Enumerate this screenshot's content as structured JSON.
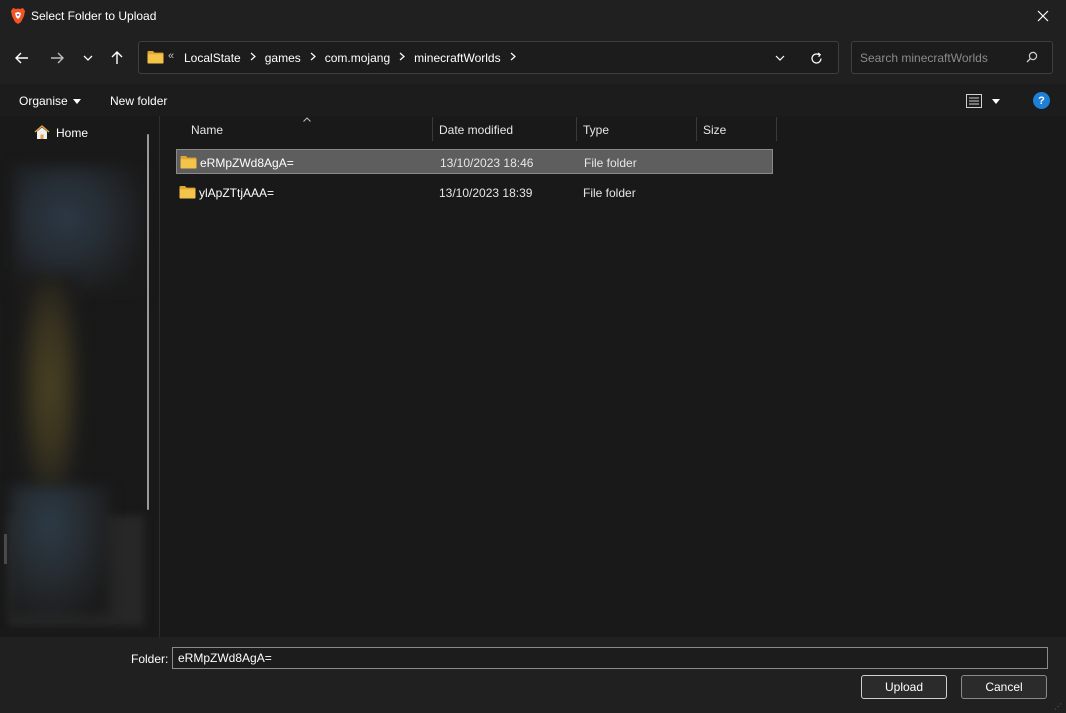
{
  "window": {
    "title": "Select Folder to Upload"
  },
  "address_bar": {
    "overflow_glyph": "«",
    "crumbs": [
      "LocalState",
      "games",
      "com.mojang",
      "minecraftWorlds"
    ]
  },
  "search": {
    "placeholder": "Search minecraftWorlds"
  },
  "toolbar": {
    "organise_label": "Organise",
    "new_folder_label": "New folder",
    "help_label": "?"
  },
  "sidebar": {
    "home_label": "Home"
  },
  "columns": {
    "name": "Name",
    "date_modified": "Date modified",
    "type": "Type",
    "size": "Size"
  },
  "files": [
    {
      "name": "eRMpZWd8AgA=",
      "date_modified": "13/10/2023 18:46",
      "type": "File folder",
      "selected": true
    },
    {
      "name": "ylApZTtjAAA=",
      "date_modified": "13/10/2023 18:39",
      "type": "File folder",
      "selected": false
    }
  ],
  "footer": {
    "folder_label": "Folder:",
    "folder_value": "eRMpZWd8AgA=",
    "upload_label": "Upload",
    "cancel_label": "Cancel"
  },
  "colors": {
    "accent_help": "#1e7fd6",
    "folder_yellow": "#f3c34a",
    "selection": "#5e5e5e"
  }
}
